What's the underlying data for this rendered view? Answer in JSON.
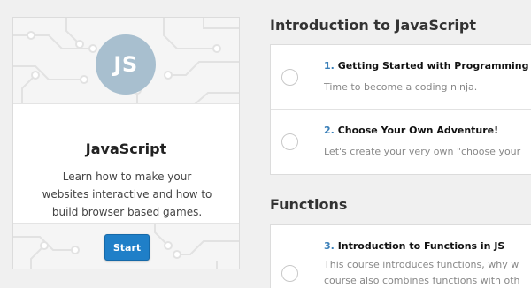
{
  "course": {
    "logo_text": "JS",
    "title": "JavaScript",
    "description": "Learn how to make your websites interactive and how to build browser based games.",
    "start_label": "Start"
  },
  "sections": [
    {
      "title": "Introduction to JavaScript",
      "lessons": [
        {
          "number": "1.",
          "title": "Getting Started with Programming",
          "desc": "Time to become a coding ninja."
        },
        {
          "number": "2.",
          "title": "Choose Your Own Adventure!",
          "desc": "Let's create your very own \"choose your"
        }
      ]
    },
    {
      "title": "Functions",
      "lessons": [
        {
          "number": "3.",
          "title": "Introduction to Functions in JS",
          "desc": "This course introduces functions, why w",
          "desc2": "course also combines functions with oth"
        }
      ]
    }
  ],
  "colors": {
    "accent": "#1f7fc8",
    "logo_bg": "#a8bfcf",
    "lesson_number": "#3a7fb8"
  }
}
